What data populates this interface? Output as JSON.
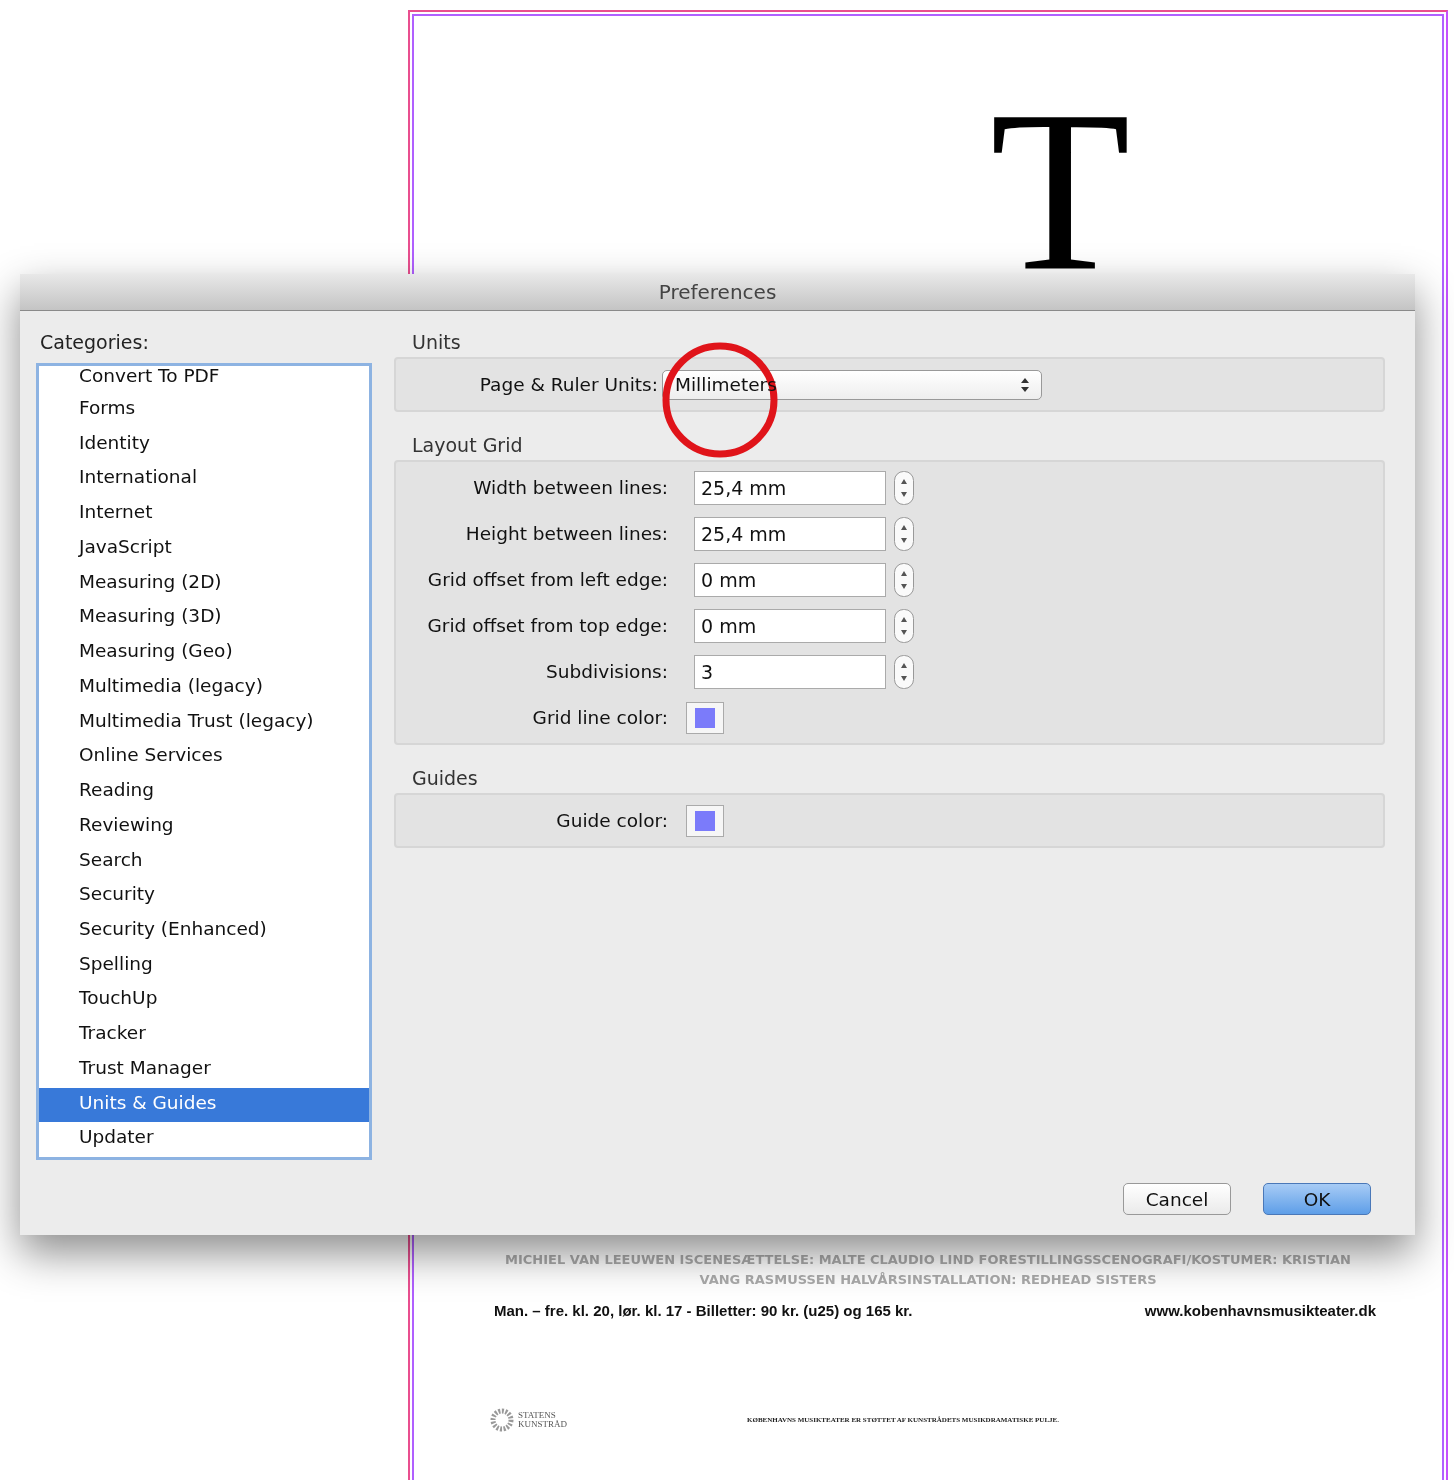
{
  "document": {
    "headline_letter": "T",
    "credits": [
      "MICHIEL VAN LEEUWEN **ISCENESÆTTELSE:** MALTE CLAUDIO LIND **FORESTILLINGSSCENOGRAFI/KOSTUMER:** KRISTIAN",
      "VANG RASMUSSEN **HALVÅRSINSTALLATION:** REDHEAD SISTERS"
    ],
    "schedule": "Man. – fre. kl. 20, lør. kl. 17 - Billetter: 90 kr. (u25) og 165 kr.",
    "website": "www.kobenhavnsmusikteater.dk",
    "logo_text": [
      "STATENS",
      "KUNSTRÅD"
    ],
    "support_note": "KØBENHAVNS MUSIKTEATER ER STØTTET AF KUNSTRÅDETS MUSIKDRAMATISKE PULJE."
  },
  "dialog": {
    "title": "Preferences",
    "categories_label": "Categories:",
    "categories": [
      {
        "label": "Convert To PDF",
        "selected": false
      },
      {
        "label": "Forms",
        "selected": false
      },
      {
        "label": "Identity",
        "selected": false
      },
      {
        "label": "International",
        "selected": false
      },
      {
        "label": "Internet",
        "selected": false
      },
      {
        "label": "JavaScript",
        "selected": false
      },
      {
        "label": "Measuring (2D)",
        "selected": false
      },
      {
        "label": "Measuring (3D)",
        "selected": false
      },
      {
        "label": "Measuring (Geo)",
        "selected": false
      },
      {
        "label": "Multimedia (legacy)",
        "selected": false
      },
      {
        "label": "Multimedia Trust (legacy)",
        "selected": false
      },
      {
        "label": "Online Services",
        "selected": false
      },
      {
        "label": "Reading",
        "selected": false
      },
      {
        "label": "Reviewing",
        "selected": false
      },
      {
        "label": "Search",
        "selected": false
      },
      {
        "label": "Security",
        "selected": false
      },
      {
        "label": "Security (Enhanced)",
        "selected": false
      },
      {
        "label": "Spelling",
        "selected": false
      },
      {
        "label": "TouchUp",
        "selected": false
      },
      {
        "label": "Tracker",
        "selected": false
      },
      {
        "label": "Trust Manager",
        "selected": false
      },
      {
        "label": "Units & Guides",
        "selected": true
      },
      {
        "label": "Updater",
        "selected": false
      }
    ],
    "sections": [
      {
        "title": "Units",
        "rows": [
          {
            "kind": "dropdown",
            "label": "Page & Ruler Units:",
            "value": "Millimeters"
          }
        ]
      },
      {
        "title": "Layout Grid",
        "rows": [
          {
            "kind": "stepper",
            "label": "Width between lines:",
            "value": "25,4 mm"
          },
          {
            "kind": "stepper",
            "label": "Height between lines:",
            "value": "25,4 mm"
          },
          {
            "kind": "stepper",
            "label": "Grid offset from left edge:",
            "value": "0 mm"
          },
          {
            "kind": "stepper",
            "label": "Grid offset from top edge:",
            "value": "0 mm"
          },
          {
            "kind": "stepper",
            "label": "Subdivisions:",
            "value": "3"
          },
          {
            "kind": "color",
            "label": "Grid line color:",
            "color": "#7b7bfa"
          }
        ]
      },
      {
        "title": "Guides",
        "rows": [
          {
            "kind": "color",
            "label": "Guide color:",
            "color": "#7b7bfa"
          }
        ]
      }
    ],
    "buttons": [
      {
        "label": "Cancel",
        "kind": "normal"
      },
      {
        "label": "OK",
        "kind": "default"
      }
    ]
  },
  "annotation": {
    "kind": "circle"
  }
}
